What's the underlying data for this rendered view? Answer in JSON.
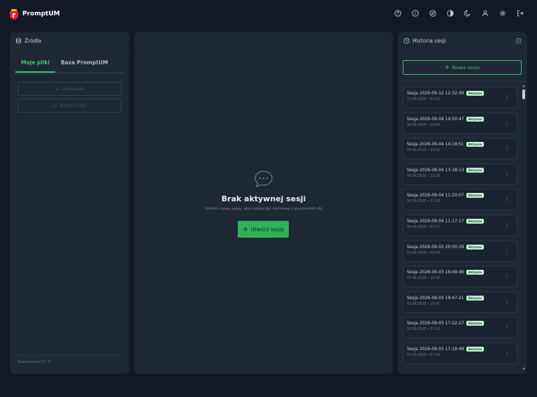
{
  "header": {
    "brand": "PromptUM"
  },
  "top_icons": [
    "help-icon",
    "info-icon",
    "compass-icon",
    "contrast-icon",
    "moon-icon",
    "user-icon",
    "gear-icon",
    "logout-icon"
  ],
  "sources": {
    "title": "Źródła",
    "tabs": [
      {
        "label": "Moje pliki",
        "active": true
      },
      {
        "label": "Baza PromptUM",
        "active": false
      }
    ],
    "add_file": "Dodaj plik",
    "add_url": "Dodaj z URL",
    "selected": "Zaznaczono 0 / 0"
  },
  "empty_state": {
    "title": "Brak aktywnej sesji",
    "subtitle": "Utwórz nową sesję, aby rozpocząć rozmowę z asystentem AI",
    "create_label": "Utwórz sesję"
  },
  "history": {
    "title": "Historia sesji",
    "new_session": "Nowa sesja",
    "sessions": [
      {
        "title": "Sesja 2026-09-12 12:32:49",
        "badge": "Aktywna",
        "date": "12.09.2026 • 12:32"
      },
      {
        "title": "Sesja 2026-09-04 14:50:47",
        "badge": "Aktywna",
        "date": "04.09.2026 • 14:50"
      },
      {
        "title": "Sesja 2026-09-04 14:19:51",
        "badge": "Aktywna",
        "date": "04.09.2026 • 14:19"
      },
      {
        "title": "Sesja 2026-09-04 13:18:13",
        "badge": "Aktywna",
        "date": "04.09.2026 • 13:18"
      },
      {
        "title": "Sesja 2026-09-04 11:20:07",
        "badge": "Aktywna",
        "date": "04.09.2026 • 11:20"
      },
      {
        "title": "Sesja 2026-09-04 11:17:17",
        "badge": "Aktywna",
        "date": "04.09.2026 • 11:17"
      },
      {
        "title": "Sesja 2026-09-03 20:00:29",
        "badge": "Aktywna",
        "date": "03.09.2026 • 20:00"
      },
      {
        "title": "Sesja 2026-09-03 19:49:46",
        "badge": "Aktywna",
        "date": "03.09.2026 • 19:49"
      },
      {
        "title": "Sesja 2026-09-03 19:47:21",
        "badge": "Aktywna",
        "date": "03.09.2026 • 19:47"
      },
      {
        "title": "Sesja 2026-09-03 17:22:27",
        "badge": "Aktywna",
        "date": "03.09.2026 • 17:22"
      },
      {
        "title": "Sesja 2026-09-03 17:19:48",
        "badge": "Aktywna",
        "date": "03.09.2026 • 17:19"
      }
    ]
  },
  "colors": {
    "accent": "#3ec46d",
    "background": "#121826",
    "panel": "#1e2734"
  }
}
